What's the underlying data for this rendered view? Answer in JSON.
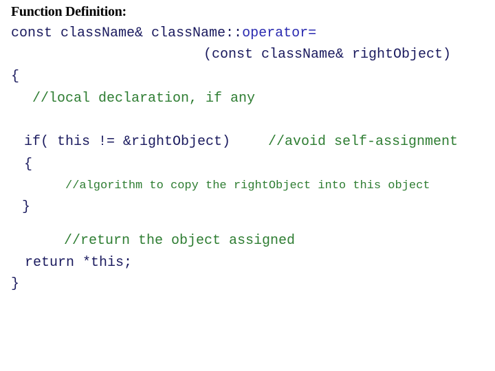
{
  "heading": "Function Definition:",
  "code": {
    "line1_a": "const className& className::",
    "line1_b": "operator=",
    "line2": "(const className& rightObject)",
    "open_brace": "{",
    "comment_local": "//local declaration, if any",
    "if_stmt": "if( this != &rightObject)",
    "comment_avoid": "//avoid self-assignment",
    "if_open": "{",
    "comment_algorithm": "//algorithm to copy the rightObject into this object",
    "if_close": "}",
    "comment_return": "//return the object assigned",
    "return_stmt": "return *this;",
    "close_brace": "}"
  },
  "colors": {
    "code": "#1a1a5e",
    "keyword": "#2a2ab0",
    "comment": "#2e7d32"
  }
}
